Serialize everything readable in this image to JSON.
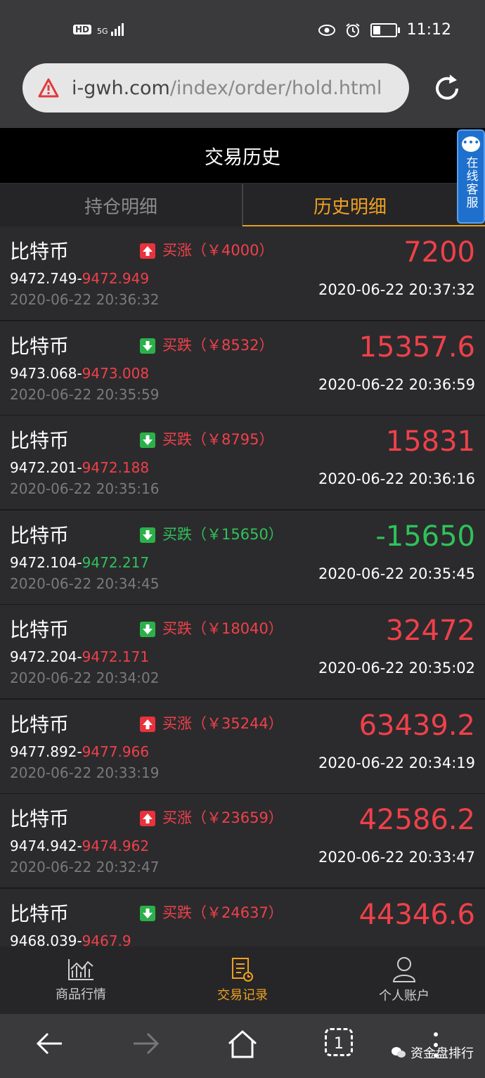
{
  "status_bar": {
    "network_left": "HD",
    "network_5g": "5G",
    "time": "11:12"
  },
  "browser": {
    "url_host": "i-gwh.com",
    "url_path": "/index/order/hold.html"
  },
  "page": {
    "title": "交易历史"
  },
  "service_tab": {
    "label": "在线客服"
  },
  "tabs": [
    {
      "label": "持仓明细",
      "active": false
    },
    {
      "label": "历史明细",
      "active": true
    }
  ],
  "records": [
    {
      "name": "比特币",
      "direction": "up",
      "direction_label": "买涨（￥4000）",
      "open_price": "9472.749",
      "close_price": "9472.949",
      "close_color": "red",
      "open_time": "2020-06-22 20:36:32",
      "result": "7200",
      "result_color": "red",
      "close_time": "2020-06-22 20:37:32"
    },
    {
      "name": "比特币",
      "direction": "down",
      "direction_label": "买跌（￥8532）",
      "open_price": "9473.068",
      "close_price": "9473.008",
      "close_color": "red",
      "open_time": "2020-06-22 20:35:59",
      "result": "15357.6",
      "result_color": "red",
      "close_time": "2020-06-22 20:36:59"
    },
    {
      "name": "比特币",
      "direction": "down",
      "direction_label": "买跌（￥8795）",
      "open_price": "9472.201",
      "close_price": "9472.188",
      "close_color": "red",
      "open_time": "2020-06-22 20:35:16",
      "result": "15831",
      "result_color": "red",
      "close_time": "2020-06-22 20:36:16"
    },
    {
      "name": "比特币",
      "direction": "down",
      "direction_label": "买跌（￥15650）",
      "open_price": "9472.104",
      "close_price": "9472.217",
      "close_color": "green",
      "open_time": "2020-06-22 20:34:45",
      "result": "-15650",
      "result_color": "green",
      "close_time": "2020-06-22 20:35:45"
    },
    {
      "name": "比特币",
      "direction": "down",
      "direction_label": "买跌（￥18040）",
      "open_price": "9472.204",
      "close_price": "9472.171",
      "close_color": "red",
      "open_time": "2020-06-22 20:34:02",
      "result": "32472",
      "result_color": "red",
      "close_time": "2020-06-22 20:35:02"
    },
    {
      "name": "比特币",
      "direction": "up",
      "direction_label": "买涨（￥35244）",
      "open_price": "9477.892",
      "close_price": "9477.966",
      "close_color": "red",
      "open_time": "2020-06-22 20:33:19",
      "result": "63439.2",
      "result_color": "red",
      "close_time": "2020-06-22 20:34:19"
    },
    {
      "name": "比特币",
      "direction": "up",
      "direction_label": "买涨（￥23659）",
      "open_price": "9474.942",
      "close_price": "9474.962",
      "close_color": "red",
      "open_time": "2020-06-22 20:32:47",
      "result": "42586.2",
      "result_color": "red",
      "close_time": "2020-06-22 20:33:47"
    },
    {
      "name": "比特币",
      "direction": "down",
      "direction_label": "买跌（￥24637）",
      "open_price": "9468.039",
      "close_price": "9467.9",
      "close_color": "red",
      "open_time": "",
      "result": "44346.6",
      "result_color": "red",
      "close_time": ""
    }
  ],
  "app_nav": [
    {
      "label": "商品行情",
      "icon": "chart-icon",
      "active": false
    },
    {
      "label": "交易记录",
      "icon": "record-icon",
      "active": true
    },
    {
      "label": "个人账户",
      "icon": "user-icon",
      "active": false
    }
  ],
  "browser_nav": {
    "tab_count": "1"
  },
  "watermark": {
    "text": "资金盘排行"
  },
  "colors": {
    "up": "#e8323c",
    "down": "#2bb04a",
    "accent": "#f0a020"
  }
}
